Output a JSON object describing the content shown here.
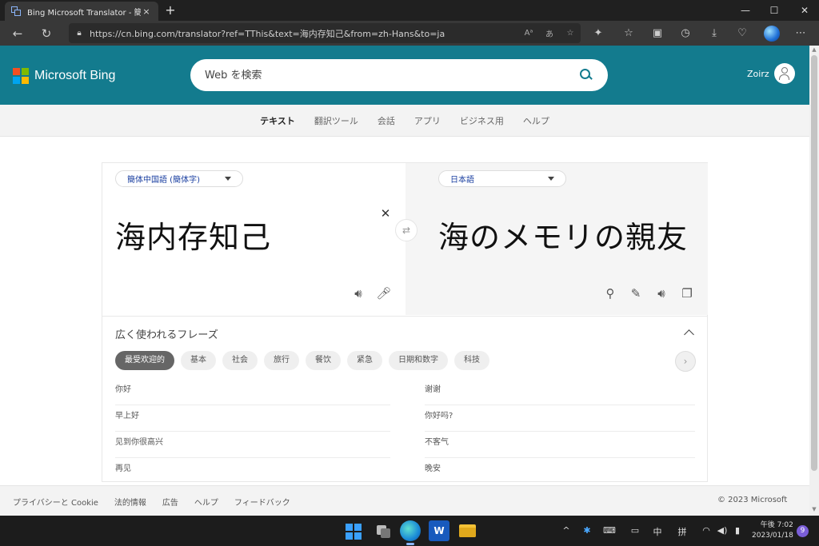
{
  "browser": {
    "tab_title": "Bing Microsoft Translator - 簡体中",
    "tab_close": "×",
    "new_tab": "+",
    "url": "https://cn.bing.com/translator?ref=TThis&text=海内存知己&from=zh-Hans&to=ja",
    "address_icons": [
      "read-aloud-icon",
      "translate-icon",
      "favorite-add-icon"
    ],
    "toolbar_icons": [
      "extensions-icon",
      "favorites-icon",
      "collections-icon",
      "history-icon",
      "downloads-icon",
      "browser-essentials-icon",
      "more-icon"
    ]
  },
  "header": {
    "logo_text": "Microsoft Bing",
    "logo_colors": [
      "#f25022",
      "#7fba00",
      "#00a4ef",
      "#ffb900"
    ],
    "search_placeholder": "Web を検索",
    "user_name": "Zoirz",
    "brand_color": "#137b8e"
  },
  "subnav": {
    "items": [
      "テキスト",
      "翻訳ツール",
      "会話",
      "アプリ",
      "ビジネス用",
      "ヘルプ"
    ],
    "active": "テキスト"
  },
  "translator": {
    "source_lang": "簡体中国語 (簡体字)",
    "target_lang": "日本語",
    "source_text": "海内存知己",
    "target_text": "海のメモリの親友",
    "clear_symbol": "✕",
    "swap_symbol": "⇄"
  },
  "phrases": {
    "title": "広く使われるフレーズ",
    "categories": [
      "最受欢迎的",
      "基本",
      "社会",
      "旅行",
      "餐饮",
      "紧急",
      "日期和数字",
      "科技"
    ],
    "active_category": "最受欢迎的",
    "next_symbol": "›",
    "left_column": [
      "你好",
      "早上好",
      "见到你很高兴",
      "再见"
    ],
    "right_column": [
      "谢谢",
      "你好吗?",
      "不客气",
      "晚安"
    ]
  },
  "footer": {
    "links": [
      "プライバシーと Cookie",
      "法的情報",
      "広告",
      "ヘルプ",
      "フィードバック"
    ],
    "copyright": "© 2023 Microsoft"
  },
  "taskbar": {
    "time": "午後 7:02",
    "date": "2023/01/18",
    "notifications": "9",
    "ime_mode": "中",
    "ime_name": "拼"
  }
}
